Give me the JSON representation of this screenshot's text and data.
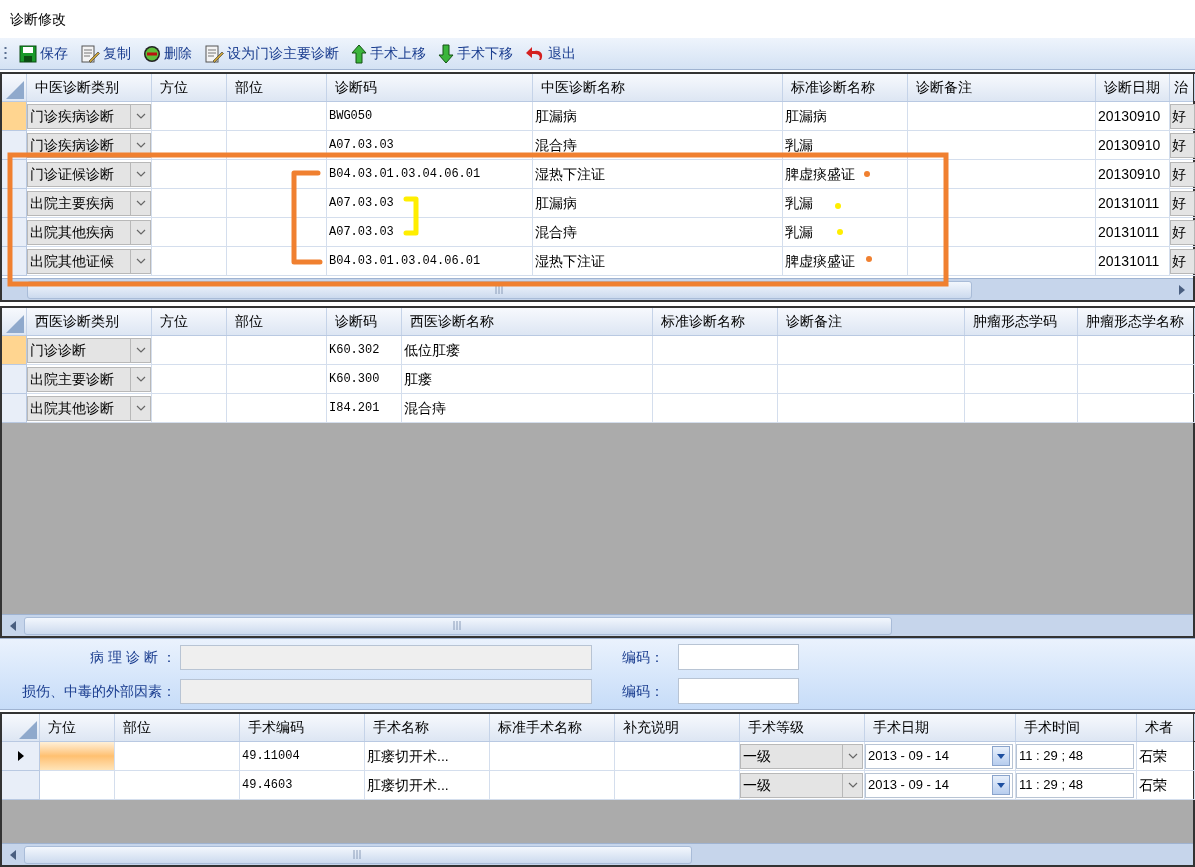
{
  "window": {
    "title": "诊断修改"
  },
  "toolbar": [
    {
      "label": "保存",
      "kind": "save"
    },
    {
      "label": "复制",
      "kind": "copy"
    },
    {
      "label": "删除",
      "kind": "delete"
    },
    {
      "label": "设为门诊主要诊断",
      "kind": "set_main"
    },
    {
      "label": "手术上移",
      "kind": "up"
    },
    {
      "label": "手术下移",
      "kind": "down"
    },
    {
      "label": "退出",
      "kind": "exit"
    }
  ],
  "tcm_grid": {
    "columns": [
      "中医诊断类别",
      "方位",
      "部位",
      "诊断码",
      "中医诊断名称",
      "标准诊断名称",
      "诊断备注",
      "诊断日期",
      "治"
    ],
    "rows": [
      {
        "selected": true,
        "category": "门诊疾病诊断",
        "code": "BWG050",
        "name": "肛漏病",
        "standard_name": "肛漏病",
        "date": "20130910",
        "column_9": "好"
      },
      {
        "selected": false,
        "category": "门诊疾病诊断",
        "code": "A07.03.03",
        "name": "混合痔",
        "standard_name": "乳漏",
        "date": "20130910",
        "column_9": "好"
      },
      {
        "selected": false,
        "category": "门诊证候诊断",
        "code": "B04.03.01.03.04.06.01",
        "name": "湿热下注证",
        "standard_name": "脾虚痰盛证",
        "date": "20130910",
        "column_9": "好"
      },
      {
        "selected": false,
        "category": "出院主要疾病",
        "code": "A07.03.03",
        "name": "肛漏病",
        "standard_name": "乳漏",
        "date": "20131011",
        "column_9": "好"
      },
      {
        "selected": false,
        "category": "出院其他疾病",
        "code": "A07.03.03",
        "name": "混合痔",
        "standard_name": "乳漏",
        "date": "20131011",
        "column_9": "好"
      },
      {
        "selected": false,
        "category": "出院其他证候",
        "code": "B04.03.01.03.04.06.01",
        "name": "湿热下注证",
        "standard_name": "脾虚痰盛证",
        "date": "20131011",
        "column_9": "好"
      }
    ]
  },
  "western_grid": {
    "columns": [
      "西医诊断类别",
      "方位",
      "部位",
      "诊断码",
      "西医诊断名称",
      "标准诊断名称",
      "诊断备注",
      "肿瘤形态学码",
      "肿瘤形态学名称"
    ],
    "rows": [
      {
        "selected": true,
        "category": "门诊诊断",
        "code": "K60.302",
        "name": "低位肛瘘"
      },
      {
        "selected": false,
        "category": "出院主要诊断",
        "code": "K60.300",
        "name": "肛瘘"
      },
      {
        "selected": false,
        "category": "出院其他诊断",
        "code": "I84.201",
        "name": "混合痔"
      }
    ]
  },
  "form": [
    {
      "label": "病 理 诊 断 ：",
      "disabled": true,
      "code_label": "编码："
    },
    {
      "label": "损伤、中毒的外部因素：",
      "disabled": true,
      "code_label": "编码："
    }
  ],
  "surgery_grid": {
    "columns": [
      "方位",
      "部位",
      "手术编码",
      "手术名称",
      "标准手术名称",
      "补充说明",
      "手术等级",
      "手术日期",
      "手术时间",
      "术者"
    ],
    "rows": [
      {
        "selected": true,
        "code": "49.11004",
        "name": "肛瘘切开术...",
        "level": "一级",
        "date": "2013 - 09 - 14",
        "time": "11 : 29 ; 48",
        "surgeon": "石荣"
      },
      {
        "selected": false,
        "code": "49.4603",
        "name": "肛瘘切开术...",
        "level": "一级",
        "date": "2013 - 09 - 14",
        "time": "11 : 29 ; 48",
        "surgeon": "石荣"
      }
    ]
  }
}
